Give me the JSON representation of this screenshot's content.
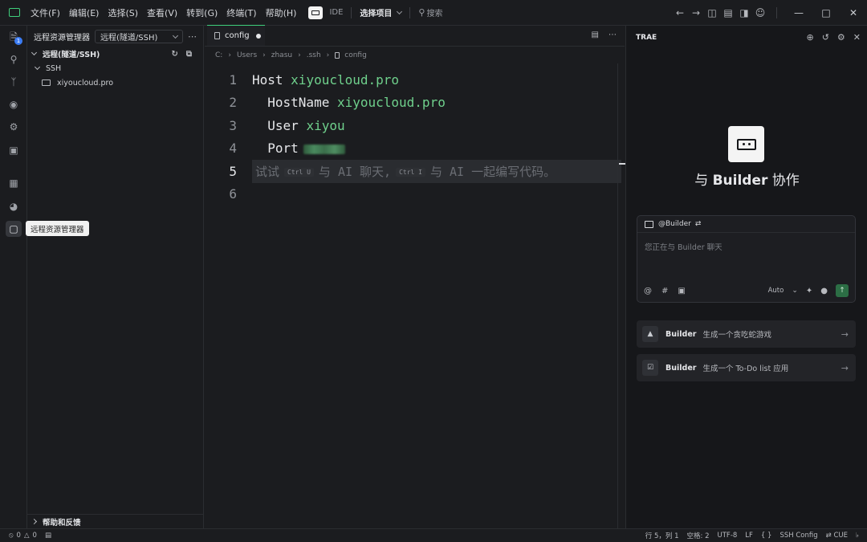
{
  "titlebar": {
    "menus": [
      "文件(F)",
      "编辑(E)",
      "选择(S)",
      "查看(V)",
      "转到(G)",
      "终端(T)",
      "帮助(H)"
    ],
    "mode_label": "IDE",
    "project_selector": "选择项目",
    "search_label": "搜索",
    "icons": [
      "back-arrow-icon",
      "forward-arrow-icon",
      "layout-left-icon",
      "layout-bottom-icon",
      "layout-right-icon",
      "account-icon"
    ]
  },
  "activity_bar": {
    "items": [
      "explorer-icon",
      "search-icon",
      "source-control-icon",
      "watch-icon",
      "debug-icon",
      "remote-display-icon",
      "extensions-icon",
      "ai-icon",
      "remote-explorer-icon"
    ],
    "explorer_badge": "1",
    "tooltip": "远程资源管理器"
  },
  "sidebar": {
    "title": "远程资源管理器",
    "selector": "远程(隧道/SSH)",
    "section_title": "远程(隧道/SSH)",
    "group": "SSH",
    "host": "xiyoucloud.pro",
    "footer": "帮助和反馈"
  },
  "editor": {
    "tab_label": "config",
    "breadcrumb": [
      "C:",
      "Users",
      "zhasu",
      ".ssh",
      "config"
    ],
    "lines": {
      "n1": "1",
      "n2": "2",
      "n3": "3",
      "n4": "4",
      "n5": "5",
      "n6": "6",
      "l1_key": "Host",
      "l1_val": "xiyoucloud.pro",
      "l2_key": "HostName",
      "l2_val": "xiyoucloud.pro",
      "l3_key": "User",
      "l3_val": "xiyou",
      "l4_key": "Port",
      "hint_a": "试试",
      "hint_kbd1": "Ctrl U",
      "hint_b": "与 AI 聊天,",
      "hint_kbd2": "Ctrl I",
      "hint_c": "与 AI 一起编写代码。"
    }
  },
  "panel": {
    "title": "TRAE",
    "hero_prefix": "与",
    "hero_name": "Builder",
    "hero_suffix": "协作",
    "chat_tag": "@Builder",
    "chat_placeholder": "您正在与 Builder 聊天",
    "model": "Auto",
    "suggestions": [
      {
        "agent": "Builder",
        "text": "生成一个贪吃蛇游戏"
      },
      {
        "agent": "Builder",
        "text": "生成一个 To-Do list 应用"
      }
    ]
  },
  "statusbar": {
    "errors": "0",
    "warnings": "0",
    "position": "行 5，列 1",
    "spaces": "空格: 2",
    "encoding": "UTF-8",
    "eol": "LF",
    "braces": "{ }",
    "language": "SSH Config",
    "cue": "CUE"
  },
  "colors": {
    "accent": "#3fcf7c",
    "value_text": "#6fd08c",
    "background": "#1b1c1f",
    "panel_bg": "#16171a",
    "badge": "#3b7cf4"
  }
}
